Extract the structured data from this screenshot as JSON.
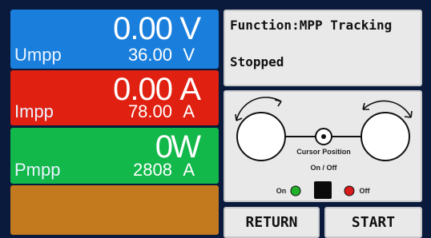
{
  "voltage": {
    "value": "0.00",
    "unit": "V",
    "label": "Umpp",
    "setpoint": "36.00",
    "setpoint_unit": "V"
  },
  "current": {
    "value": "0.00",
    "unit": "A",
    "label": "Impp",
    "setpoint": "78.00",
    "setpoint_unit": "A"
  },
  "power": {
    "value": "0",
    "unit": "W",
    "label": "Pmpp",
    "setpoint": "2808",
    "setpoint_unit": "A"
  },
  "info": {
    "function": "Function:MPP Tracking",
    "status": "Stopped"
  },
  "controls": {
    "cursor_position": "Cursor Position",
    "on_off": "On / Off",
    "on": "On",
    "off": "Off",
    "on_color": "#22b02a",
    "off_color": "#d81b1b"
  },
  "buttons": {
    "return": "RETURN",
    "start": "START"
  },
  "colors": {
    "voltage_panel": "#1a7fdc",
    "current_panel": "#e02010",
    "power_panel": "#12b84a",
    "empty_panel": "#c37a1f",
    "background": "#0a1a3c"
  }
}
